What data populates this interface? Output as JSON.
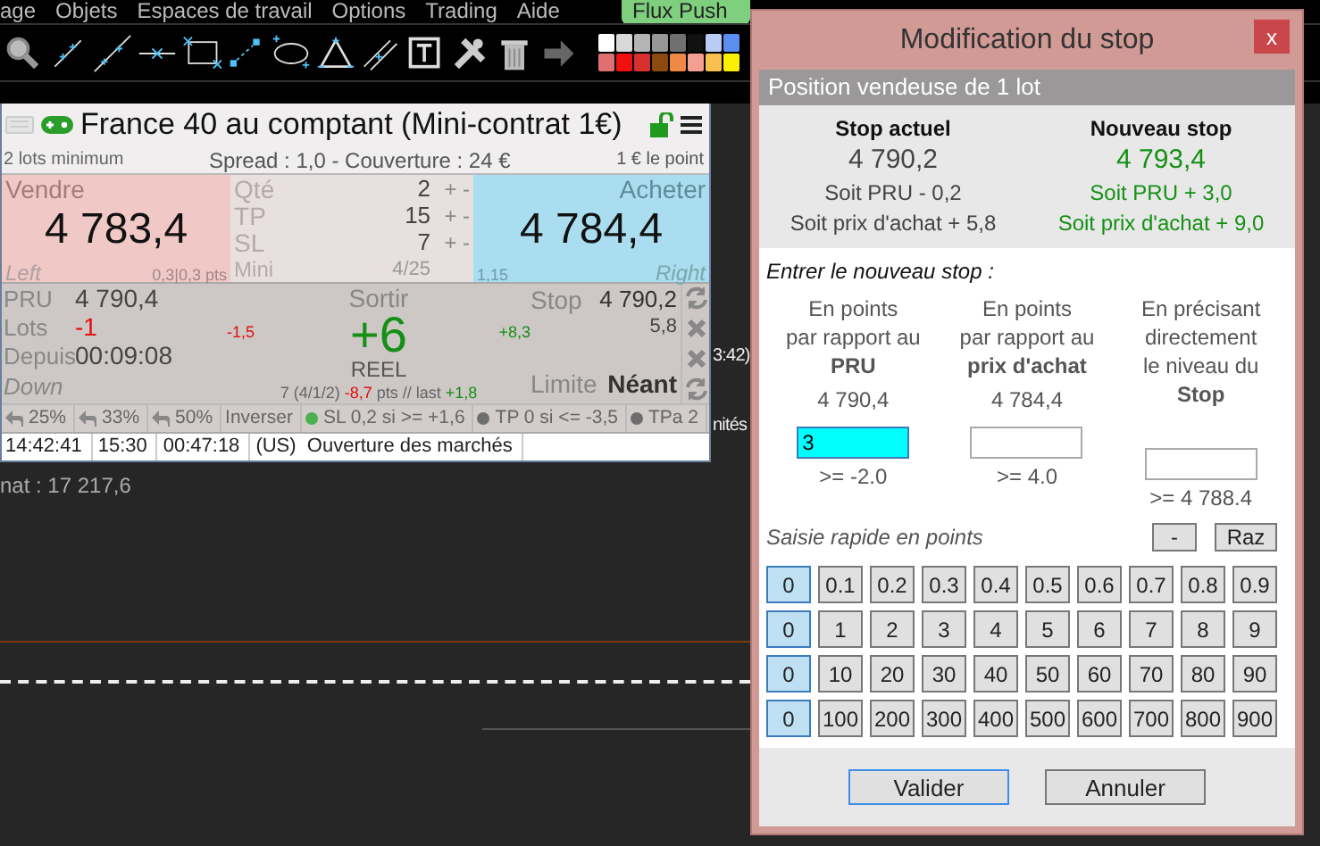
{
  "menu": [
    {
      "label": "age"
    },
    {
      "label": "Objets"
    },
    {
      "label": "Espaces de travail"
    },
    {
      "label": "Options"
    },
    {
      "label": "Trading"
    },
    {
      "label": "Aide"
    }
  ],
  "flux_push": {
    "label": "Flux Push"
  },
  "palette": [
    {
      "color": "#ffffff"
    },
    {
      "color": "#d8d8d8"
    },
    {
      "color": "#b4b4b4"
    },
    {
      "color": "#969696"
    },
    {
      "color": "#707070"
    },
    {
      "color": "#111111"
    },
    {
      "color": "#b8ccf4"
    },
    {
      "color": "#5c8ef0"
    },
    {
      "color": "#e07070"
    },
    {
      "color": "#f01010"
    },
    {
      "color": "#d83030"
    },
    {
      "color": "#8a4a10"
    },
    {
      "color": "#f08848"
    },
    {
      "color": "#f4a090"
    },
    {
      "color": "#f8c050"
    },
    {
      "color": "#f8f000"
    }
  ],
  "panel": {
    "title": "France 40 au comptant (Mini-contrat 1€)",
    "info": [
      "2 lots minimum",
      "Spread : 1,0 - Couverture : 24 €",
      "1 € le point"
    ],
    "sell": {
      "label": "Vendre",
      "price": "4 783,4",
      "corner": "Left",
      "note": "0,3|0,3 pts"
    },
    "params": [
      {
        "label": "Qté",
        "value": "2",
        "adjust": "+ -"
      },
      {
        "label": "TP",
        "value": "15",
        "adjust": "+ -"
      },
      {
        "label": "SL",
        "value": "7",
        "adjust": "+ -"
      },
      {
        "label": "Mini",
        "value": "4/25"
      }
    ],
    "buy": {
      "label": "Acheter",
      "price": "4 784,4",
      "corner": "Right",
      "note": "1,15"
    },
    "position": {
      "fields": [
        {
          "label": "PRU",
          "value": "4 790,4",
          "color": "#444444"
        },
        {
          "label": "Lots",
          "value": "-1",
          "color": "#e01010"
        },
        {
          "label": "Depuis",
          "value": "00:09:08",
          "color": "#444444"
        }
      ],
      "trend": "Down",
      "low": "-1,5",
      "exit_label": "Sortir",
      "result": "+6",
      "mode": "REEL",
      "high": "+8,3",
      "detail": [
        {
          "text": "7 (4/1/2) ",
          "color": "#666666"
        },
        {
          "text": "-8,7",
          "color": "#e01010"
        },
        {
          "text": " pts // last ",
          "color": "#666666"
        },
        {
          "text": "+1,8",
          "color": "#159015"
        }
      ],
      "stop_label": "Stop",
      "stop_value": "4 790,2",
      "stop_diff": "5,8",
      "limit_label": "Limite",
      "limit_value": "Néant"
    },
    "actions": [
      {
        "label": "25%",
        "kind": "reduce"
      },
      {
        "label": "33%",
        "kind": "reduce"
      },
      {
        "label": "50%",
        "kind": "reduce"
      },
      {
        "label": "Inverser",
        "kind": "plain"
      },
      {
        "label": "SL 0,2 si >= +1,6",
        "kind": "dot",
        "color": "#4caf50"
      },
      {
        "label": "TP 0 si <= -3,5",
        "kind": "dot",
        "color": "#6e6e6e"
      },
      {
        "label": "TPa 2",
        "kind": "dot",
        "color": "#6e6e6e"
      }
    ],
    "status": [
      "14:42:41",
      "15:30",
      "00:47:18",
      "(US)  Ouverture des marchés"
    ]
  },
  "chart": {
    "labels": [
      "nat : 17 217,6",
      "3:42)",
      "nités"
    ]
  },
  "dialog": {
    "title": "Modification du stop",
    "close": "x",
    "header": "Position vendeuse de 1 lot",
    "stops": [
      {
        "title": "Stop actuel",
        "value": "4 790,2",
        "pru": "Soit PRU - 0,2",
        "purchase": "Soit prix d'achat + 5,8",
        "color": "#444444"
      },
      {
        "title": "Nouveau stop",
        "value": "4 793,4",
        "pru": "Soit PRU + 3,0",
        "purchase": "Soit prix d'achat + 9,0",
        "color": "#159015"
      }
    ],
    "prompt": "Entrer le nouveau stop :",
    "entries": [
      {
        "caption": "En points\npar rapport au\n**PRU**",
        "reference": "4 790,4",
        "value": "3",
        "focused": true,
        "hint": ">= -2.0"
      },
      {
        "caption": "En points\npar rapport au\n**prix d'achat**",
        "reference": "4 784,4",
        "focused": false,
        "hint": ">= 4.0"
      },
      {
        "caption": "En précisant\ndirectement\nle niveau du\n**Stop**",
        "focused": false,
        "hint": ">= 4 788.4"
      }
    ],
    "quick_label": "Saisie rapide en points",
    "quick_tools": [
      "-",
      "Raz"
    ],
    "quick_rows": [
      [
        {
          "label": "0",
          "selected": true
        },
        {
          "label": "0.1",
          "selected": false
        },
        {
          "label": "0.2",
          "selected": false
        },
        {
          "label": "0.3",
          "selected": false
        },
        {
          "label": "0.4",
          "selected": false
        },
        {
          "label": "0.5",
          "selected": false
        },
        {
          "label": "0.6",
          "selected": false
        },
        {
          "label": "0.7",
          "selected": false
        },
        {
          "label": "0.8",
          "selected": false
        },
        {
          "label": "0.9",
          "selected": false
        }
      ],
      [
        {
          "label": "0",
          "selected": true
        },
        {
          "label": "1",
          "selected": false
        },
        {
          "label": "2",
          "selected": false
        },
        {
          "label": "3",
          "selected": false
        },
        {
          "label": "4",
          "selected": false
        },
        {
          "label": "5",
          "selected": false
        },
        {
          "label": "6",
          "selected": false
        },
        {
          "label": "7",
          "selected": false
        },
        {
          "label": "8",
          "selected": false
        },
        {
          "label": "9",
          "selected": false
        }
      ],
      [
        {
          "label": "0",
          "selected": true
        },
        {
          "label": "10",
          "selected": false
        },
        {
          "label": "20",
          "selected": false
        },
        {
          "label": "30",
          "selected": false
        },
        {
          "label": "40",
          "selected": false
        },
        {
          "label": "50",
          "selected": false
        },
        {
          "label": "60",
          "selected": false
        },
        {
          "label": "70",
          "selected": false
        },
        {
          "label": "80",
          "selected": false
        },
        {
          "label": "90",
          "selected": false
        }
      ],
      [
        {
          "label": "0",
          "selected": true
        },
        {
          "label": "100",
          "selected": false
        },
        {
          "label": "200",
          "selected": false
        },
        {
          "label": "300",
          "selected": false
        },
        {
          "label": "400",
          "selected": false
        },
        {
          "label": "500",
          "selected": false
        },
        {
          "label": "600",
          "selected": false
        },
        {
          "label": "700",
          "selected": false
        },
        {
          "label": "800",
          "selected": false
        },
        {
          "label": "900",
          "selected": false
        }
      ]
    ],
    "buttons": [
      {
        "label": "Valider",
        "default": true
      },
      {
        "label": "Annuler",
        "default": false
      }
    ]
  }
}
